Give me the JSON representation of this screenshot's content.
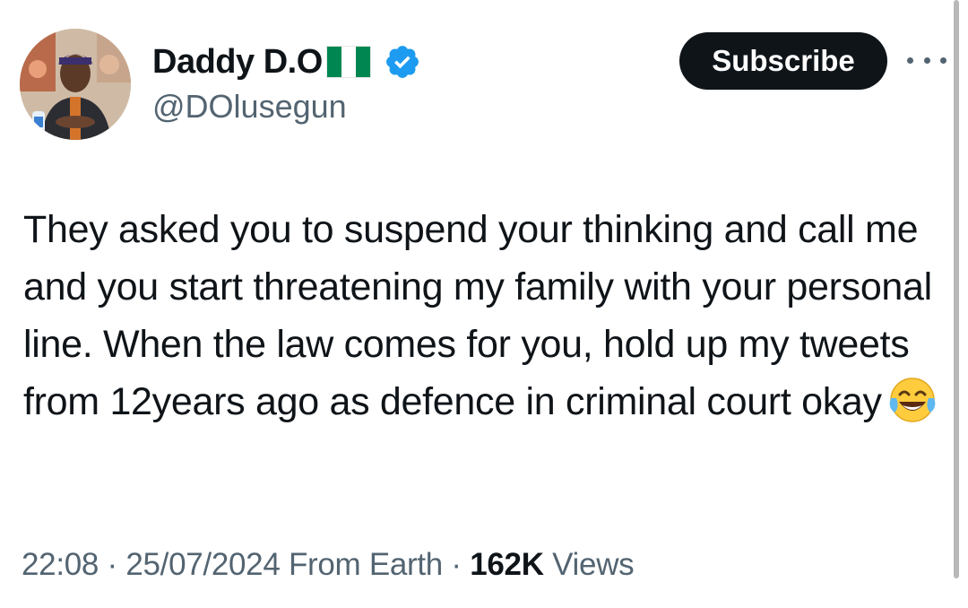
{
  "author": {
    "display_name": "Daddy D.O",
    "flag": "nigeria-flag-icon",
    "verified": true,
    "handle": "@DOlusegun"
  },
  "actions": {
    "subscribe_label": "Subscribe",
    "more_icon": "more-horizontal-icon"
  },
  "tweet": {
    "text": "They asked you to suspend your thinking and call me and you start threatening my family with your personal line. When the law comes for you, hold up my tweets from 12years ago as defence in criminal court okay",
    "emoji": "face-with-tears-of-joy-icon"
  },
  "meta": {
    "time": "22:08",
    "separator": "·",
    "date": "25/07/2024",
    "source": "From Earth",
    "views_count": "162K",
    "views_label": "Views"
  },
  "colors": {
    "text_primary": "#0f1419",
    "text_secondary": "#536471",
    "verified_blue": "#1d9bf0",
    "button_bg": "#0f1419",
    "flag_green": "#008751"
  }
}
